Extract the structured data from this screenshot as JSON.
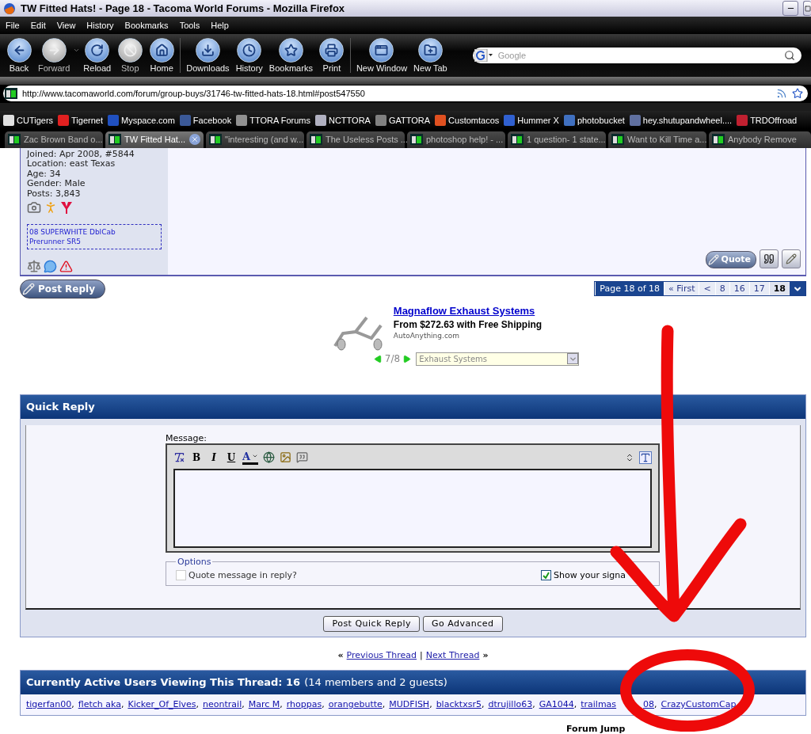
{
  "window": {
    "title": "TW Fitted Hats! - Page 18 - Tacoma World Forums - Mozilla Firefox"
  },
  "menu": [
    "File",
    "Edit",
    "View",
    "History",
    "Bookmarks",
    "Tools",
    "Help"
  ],
  "toolbar": [
    {
      "kind": "back",
      "label": "Back",
      "disabled": false
    },
    {
      "kind": "forward",
      "label": "Forward",
      "disabled": true
    },
    {
      "kind": "dropdown"
    },
    {
      "kind": "reload",
      "label": "Reload",
      "disabled": false
    },
    {
      "kind": "stop",
      "label": "Stop",
      "disabled": true
    },
    {
      "kind": "home",
      "label": "Home",
      "disabled": false
    },
    {
      "kind": "separator"
    },
    {
      "kind": "downloads",
      "label": "Downloads",
      "disabled": false
    },
    {
      "kind": "history",
      "label": "History",
      "disabled": false
    },
    {
      "kind": "bookmarks",
      "label": "Bookmarks",
      "disabled": false
    },
    {
      "kind": "print",
      "label": "Print",
      "disabled": false
    },
    {
      "kind": "separator"
    },
    {
      "kind": "new_window",
      "label": "New Window",
      "disabled": false
    },
    {
      "kind": "new_tab",
      "label": "New Tab",
      "disabled": false
    }
  ],
  "search": {
    "placeholder": "Google"
  },
  "address": {
    "value": "http://www.tacomaworld.com/forum/group-buys/31746-tw-fitted-hats-18.html#post547550"
  },
  "bookmarks": [
    {
      "label": "CUTigers",
      "color": "#e0e0e0"
    },
    {
      "label": "Tigernet",
      "color": "#e02020"
    },
    {
      "label": "Myspace.com",
      "color": "#2050c0"
    },
    {
      "label": "Facebook",
      "color": "#3b5998"
    },
    {
      "label": "TTORA Forums",
      "color": "#909090"
    },
    {
      "label": "NCTTORA",
      "color": "#b0b0c0"
    },
    {
      "label": "GATTORA",
      "color": "#808080"
    },
    {
      "label": "Customtacos",
      "color": "#e05020"
    },
    {
      "label": "Hummer X",
      "color": "#3060d0"
    },
    {
      "label": "photobucket",
      "color": "#4070c0"
    },
    {
      "label": "hey.shutupandwheel....",
      "color": "#6070a0"
    },
    {
      "label": "TRDOffroad",
      "color": "#c02030"
    }
  ],
  "tabs": [
    {
      "label": "Zac Brown Band o...",
      "selected": false
    },
    {
      "label": "TW Fitted Hat...",
      "selected": true
    },
    {
      "label": "\"interesting (and w...",
      "selected": false
    },
    {
      "label": "The Useless Posts ...",
      "selected": false
    },
    {
      "label": "photoshop help! - ...",
      "selected": false
    },
    {
      "label": "1 question- 1 state...",
      "selected": false
    },
    {
      "label": "Want to Kill Time a...",
      "selected": false
    },
    {
      "label": "Anybody Remove",
      "selected": false
    }
  ],
  "post": {
    "user_info": [
      "Joined: Apr 2008, #5844",
      "Location: east Texas",
      "Age: 34",
      "Gender: Male",
      "Posts: 3,843"
    ],
    "vehicle": [
      "08 SUPERWHITE DblCab",
      "Prerunner SR5"
    ],
    "quote_button": "Quote"
  },
  "post_reply_button": "Post Reply",
  "pagination": {
    "summary": "Page 18 of 18",
    "first": "« First",
    "prev": "<",
    "pages": [
      {
        "label": "8",
        "selected": false
      },
      {
        "label": "16",
        "selected": false
      },
      {
        "label": "17",
        "selected": false
      },
      {
        "label": "18",
        "selected": true
      }
    ]
  },
  "ad": {
    "title": "Magnaflow Exhaust Systems",
    "price": "From $272.63 with Free Shipping",
    "source": "AutoAnything.com",
    "counter": "7/8",
    "category": "Exhaust Systems"
  },
  "quick_reply": {
    "title": "Quick Reply",
    "message_label": "Message:",
    "format_buttons": [
      "B",
      "I",
      "U"
    ],
    "font_color": "A",
    "options_legend": "Options",
    "options": [
      {
        "label": "Quote message in reply?",
        "checked": false,
        "disabled": true
      },
      {
        "label": "Show your signa",
        "checked": true,
        "disabled": false
      }
    ],
    "buttons": [
      "Post Quick Reply",
      "Go Advanced"
    ]
  },
  "thread_nav": {
    "prev_mark": "«",
    "previous": "Previous Thread",
    "divider": "|",
    "next": "Next Thread",
    "next_mark": "»"
  },
  "active_users": {
    "title": "Currently Active Users Viewing This Thread: 16",
    "detail": "(14 members and 2 guests)",
    "separator": ",",
    "users": [
      {
        "parts": [
          "tigerfan00"
        ]
      },
      {
        "parts": [
          "fletch aka"
        ]
      },
      {
        "parts": [
          "Kicker_Of_Elves"
        ]
      },
      {
        "parts": [
          "neontrail"
        ]
      },
      {
        "parts": [
          "Marc M"
        ]
      },
      {
        "parts": [
          "rhoppas"
        ]
      },
      {
        "parts": [
          "orangebutte"
        ]
      },
      {
        "parts": [
          "MUDFISH"
        ]
      },
      {
        "parts": [
          "blacktxsr5"
        ]
      },
      {
        "parts": [
          "dtrujillo63"
        ]
      },
      {
        "parts": [
          "GA1044"
        ]
      },
      {
        "parts": [
          "trailmas",
          "08"
        ]
      },
      {
        "parts": [
          "CrazyCustomCap"
        ]
      }
    ]
  },
  "forum_jump": "Forum Jump",
  "annotations": {
    "arrow": true,
    "circle": true
  }
}
